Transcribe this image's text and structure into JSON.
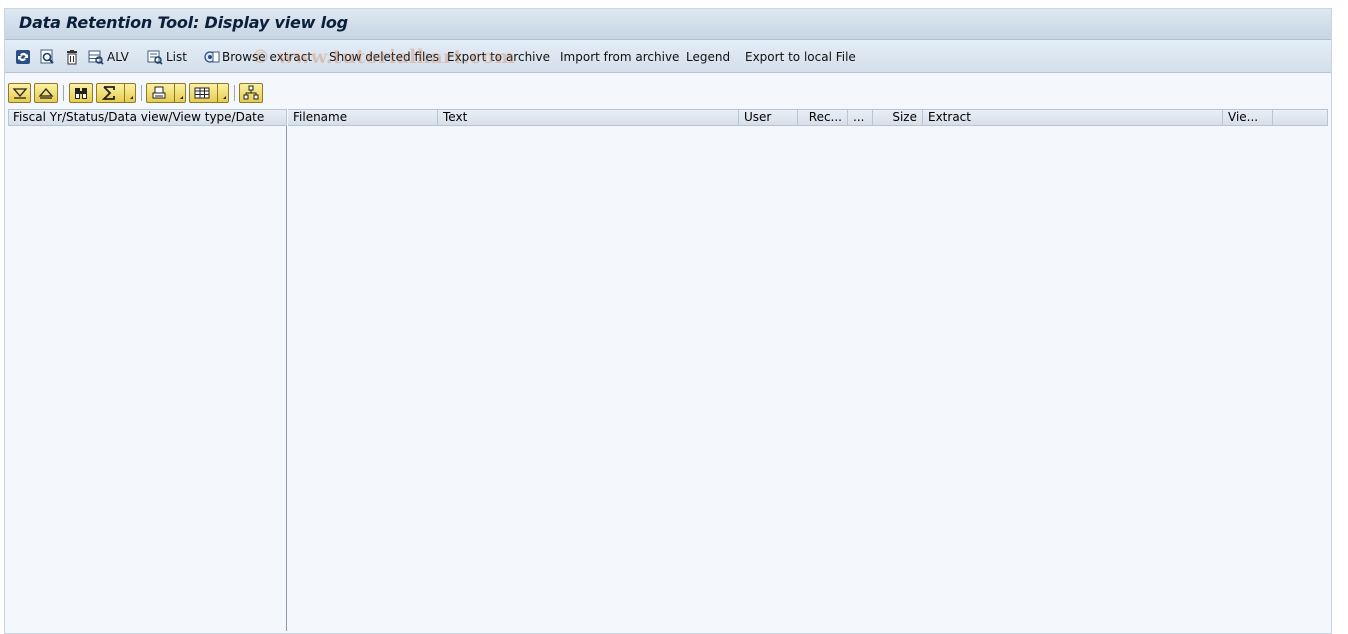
{
  "window": {
    "title": "Data Retention Tool: Display view log"
  },
  "toolbar": {
    "items": [
      {
        "icon": "refresh-icon",
        "label": ""
      },
      {
        "icon": "display-icon",
        "label": ""
      },
      {
        "icon": "delete-icon",
        "label": ""
      },
      {
        "icon": "alv-icon",
        "label": "ALV"
      },
      {
        "icon": "list-icon",
        "label": "List"
      },
      {
        "icon": "browse-icon",
        "label": "Browse extract"
      },
      {
        "icon": "",
        "label": "Show deleted files"
      },
      {
        "icon": "",
        "label": "Export to archive"
      },
      {
        "icon": "",
        "label": "Import from archive"
      },
      {
        "icon": "",
        "label": "Legend"
      },
      {
        "icon": "",
        "label": "Export to local File"
      }
    ]
  },
  "watermark": "© www.tutorialkart.com",
  "alv_toolbar": {
    "buttons": [
      "expand-all-icon",
      "collapse-all-icon",
      "find-icon",
      "sum-icon",
      "print-icon",
      "layout-icon",
      "hierarchy-icon"
    ]
  },
  "tree": {
    "header": "Fiscal Yr/Status/Data view/View type/Date"
  },
  "grid": {
    "columns": [
      "Filename",
      "Text",
      "User",
      "Rec...",
      "...",
      "Size",
      "Extract",
      "Vie..."
    ]
  },
  "colors": {
    "window_bg": "#f4f8fc",
    "titlebar": "#c6d4e3",
    "alv_button": "#e7cc4f"
  }
}
